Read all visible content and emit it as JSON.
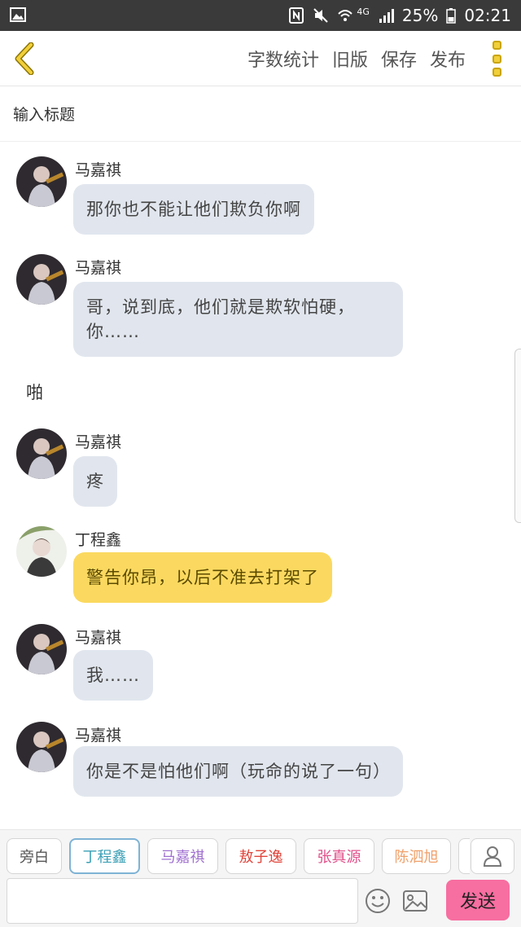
{
  "status_bar": {
    "battery": "25%",
    "time": "02:21",
    "network": "4G"
  },
  "toolbar": {
    "word_count_label": "字数统计",
    "old_version_label": "旧版",
    "save_label": "保存",
    "publish_label": "发布"
  },
  "title_field": {
    "placeholder": "输入标题",
    "value": ""
  },
  "messages": [
    {
      "speaker": "马嘉祺",
      "text": "那你也不能让他们欺负你啊",
      "style": "gray"
    },
    {
      "speaker": "马嘉祺",
      "text": "哥，说到底，他们就是欺软怕硬，你……",
      "style": "gray"
    },
    {
      "speaker": "",
      "text": "啪",
      "style": "narration"
    },
    {
      "speaker": "马嘉祺",
      "text": "疼",
      "style": "gray"
    },
    {
      "speaker": "丁程鑫",
      "text": "警告你昂，以后不准去打架了",
      "style": "yellow"
    },
    {
      "speaker": "马嘉祺",
      "text": "我……",
      "style": "gray"
    },
    {
      "speaker": "马嘉祺",
      "text": "你是不是怕他们啊（玩命的说了一句）",
      "style": "gray"
    }
  ],
  "roles": [
    {
      "label": "旁白",
      "color": "#555555"
    },
    {
      "label": "丁程鑫",
      "color": "#3a9fb5",
      "selected": true
    },
    {
      "label": "马嘉祺",
      "color": "#a070d0"
    },
    {
      "label": "敖子逸",
      "color": "#e0463c"
    },
    {
      "label": "张真源",
      "color": "#e0508a"
    },
    {
      "label": "陈泗旭",
      "color": "#f0a06a"
    }
  ],
  "input": {
    "value": "",
    "send_label": "发送"
  },
  "colors": {
    "accent_yellow": "#f1cf3a",
    "bubble_gray": "#e1e6ee",
    "bubble_yellow": "#fbd960",
    "send_pink": "#f76ea0"
  },
  "icons": [
    "image-icon",
    "nfc-icon",
    "mute-icon",
    "wifi-icon",
    "signal-icon",
    "battery-icon",
    "back-chevron-icon",
    "more-icon",
    "emoji-icon",
    "picture-icon",
    "user-icon"
  ]
}
